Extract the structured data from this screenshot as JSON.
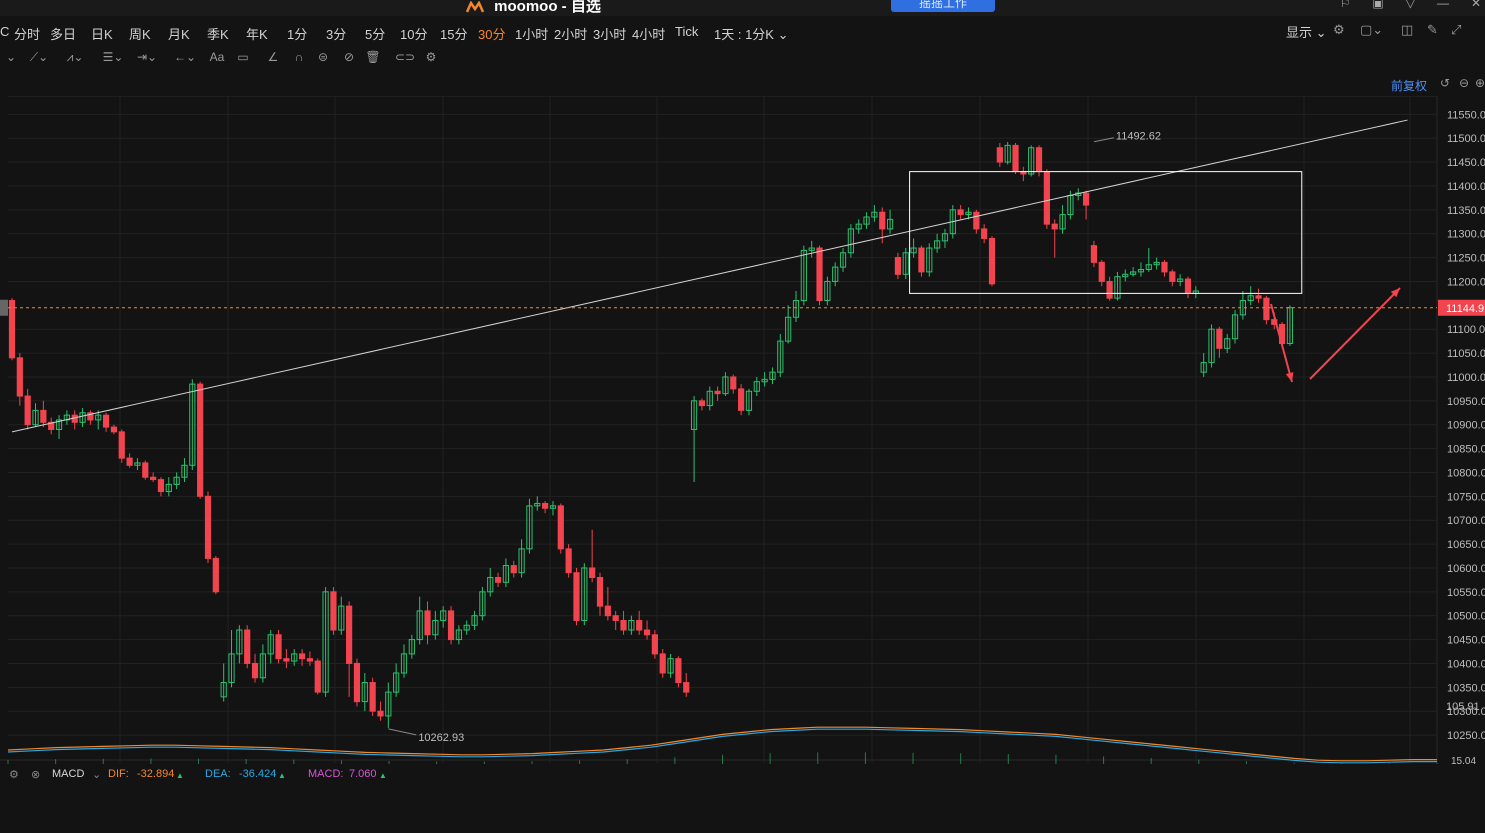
{
  "app": {
    "title": "moomoo - 自选",
    "share_label": "摇摇工作"
  },
  "timeframes": [
    {
      "label": "C",
      "active": false
    },
    {
      "label": "分时",
      "active": false
    },
    {
      "label": "多日",
      "active": false
    },
    {
      "label": "日K",
      "active": false
    },
    {
      "label": "周K",
      "active": false
    },
    {
      "label": "月K",
      "active": false
    },
    {
      "label": "季K",
      "active": false
    },
    {
      "label": "年K",
      "active": false
    },
    {
      "label": "1分",
      "active": false
    },
    {
      "label": "3分",
      "active": false
    },
    {
      "label": "5分",
      "active": false
    },
    {
      "label": "10分",
      "active": false
    },
    {
      "label": "15分",
      "active": false
    },
    {
      "label": "30分",
      "active": true
    },
    {
      "label": "1小时",
      "active": false
    },
    {
      "label": "2小时",
      "active": false
    },
    {
      "label": "3小时",
      "active": false
    },
    {
      "label": "4小时",
      "active": false
    },
    {
      "label": "Tick",
      "active": false
    }
  ],
  "period_select": "1天 : 1分K",
  "display_label": "显示",
  "adjust_label": "前复权",
  "indicator": {
    "name": "MACD",
    "dif_label": "DIF:",
    "dif_value": "-32.894",
    "dea_label": "DEA:",
    "dea_value": "-36.424",
    "macd_label": "MACD:",
    "macd_value": "7.060"
  },
  "colors": {
    "up": "#2cc16f",
    "down": "#f2444e",
    "accent": "#f5872b",
    "dif": "#f5872b",
    "dea": "#2aa8e0",
    "macd": "#d656d6"
  },
  "chart_data": {
    "type": "candlestick",
    "y_ticks": [
      11550,
      11500,
      11450,
      11400,
      11350,
      11300,
      11250,
      11200,
      11100,
      11050,
      11000,
      10950,
      10900,
      10850,
      10800,
      10750,
      10700,
      10650,
      10600,
      10550,
      10500,
      10450,
      10400,
      10350,
      10300,
      10250
    ],
    "y_tick_labels": [
      "11550.00",
      "11500.00",
      "11450.00",
      "11400.00",
      "11350.00",
      "11300.00",
      "11250.00",
      "11200.00",
      "11100.00",
      "11050.00",
      "11000.00",
      "10950.00",
      "10900.00",
      "10850.00",
      "10800.00",
      "10750.00",
      "10700.00",
      "10650.00",
      "10600.00",
      "10550.00",
      "10500.00",
      "10450.00",
      "10400.00",
      "10350.00",
      "10300.00",
      "10250.00"
    ],
    "ylim": [
      10225,
      11580
    ],
    "last_price": 11144.9,
    "last_price_label": "11144.9",
    "max_label": "11492.62",
    "min_label": "10262.93",
    "macd_axis_label": "105.91",
    "macd_axis_label2": "15.04",
    "trendline": [
      [
        0,
        10885
      ],
      [
        178,
        11538
      ]
    ],
    "box": {
      "from": 115,
      "to": 164,
      "high": 11430,
      "low": 11175
    },
    "candles": [
      [
        11160,
        11040,
        11165,
        11035
      ],
      [
        11040,
        10960,
        11050,
        10940
      ],
      [
        10960,
        10900,
        10975,
        10890
      ],
      [
        10900,
        10930,
        10945,
        10895
      ],
      [
        10930,
        10905,
        10950,
        10895
      ],
      [
        10905,
        10890,
        10915,
        10880
      ],
      [
        10890,
        10910,
        10920,
        10870
      ],
      [
        10910,
        10920,
        10930,
        10900
      ],
      [
        10920,
        10905,
        10930,
        10890
      ],
      [
        10905,
        10925,
        10935,
        10895
      ],
      [
        10925,
        10910,
        10930,
        10900
      ],
      [
        10910,
        10920,
        10930,
        10890
      ],
      [
        10920,
        10895,
        10925,
        10885
      ],
      [
        10895,
        10885,
        10900,
        10880
      ],
      [
        10885,
        10830,
        10890,
        10820
      ],
      [
        10830,
        10815,
        10840,
        10810
      ],
      [
        10815,
        10820,
        10830,
        10805
      ],
      [
        10820,
        10790,
        10825,
        10785
      ],
      [
        10790,
        10785,
        10800,
        10780
      ],
      [
        10785,
        10760,
        10790,
        10750
      ],
      [
        10760,
        10775,
        10790,
        10750
      ],
      [
        10775,
        10790,
        10800,
        10765
      ],
      [
        10790,
        10815,
        10830,
        10780
      ],
      [
        10815,
        10985,
        10995,
        10805
      ],
      [
        10985,
        10750,
        10990,
        10745
      ],
      [
        10750,
        10620,
        10760,
        10610
      ],
      [
        10620,
        10550,
        10625,
        10545
      ],
      [
        10330,
        10360,
        10400,
        10320
      ],
      [
        10360,
        10420,
        10470,
        10350
      ],
      [
        10420,
        10470,
        10480,
        10400
      ],
      [
        10470,
        10400,
        10480,
        10390
      ],
      [
        10400,
        10370,
        10420,
        10360
      ],
      [
        10370,
        10420,
        10440,
        10360
      ],
      [
        10420,
        10460,
        10470,
        10400
      ],
      [
        10460,
        10410,
        10470,
        10400
      ],
      [
        10410,
        10405,
        10430,
        10390
      ],
      [
        10405,
        10420,
        10430,
        10395
      ],
      [
        10420,
        10410,
        10430,
        10395
      ],
      [
        10410,
        10405,
        10425,
        10395
      ],
      [
        10405,
        10340,
        10410,
        10335
      ],
      [
        10340,
        10550,
        10560,
        10330
      ],
      [
        10550,
        10470,
        10560,
        10460
      ],
      [
        10470,
        10520,
        10540,
        10460
      ],
      [
        10520,
        10400,
        10530,
        10330
      ],
      [
        10400,
        10320,
        10410,
        10310
      ],
      [
        10320,
        10360,
        10380,
        10300
      ],
      [
        10360,
        10300,
        10370,
        10290
      ],
      [
        10300,
        10290,
        10320,
        10280
      ],
      [
        10290,
        10340,
        10360,
        10265
      ],
      [
        10340,
        10380,
        10400,
        10330
      ],
      [
        10380,
        10420,
        10440,
        10370
      ],
      [
        10420,
        10450,
        10460,
        10410
      ],
      [
        10450,
        10510,
        10540,
        10440
      ],
      [
        10510,
        10460,
        10530,
        10440
      ],
      [
        10460,
        10490,
        10510,
        10450
      ],
      [
        10490,
        10510,
        10520,
        10475
      ],
      [
        10510,
        10450,
        10520,
        10440
      ],
      [
        10450,
        10470,
        10480,
        10440
      ],
      [
        10470,
        10480,
        10490,
        10460
      ],
      [
        10480,
        10500,
        10510,
        10470
      ],
      [
        10500,
        10550,
        10560,
        10490
      ],
      [
        10550,
        10580,
        10600,
        10540
      ],
      [
        10580,
        10570,
        10590,
        10560
      ],
      [
        10570,
        10605,
        10620,
        10560
      ],
      [
        10605,
        10590,
        10615,
        10580
      ],
      [
        10590,
        10640,
        10660,
        10580
      ],
      [
        10640,
        10730,
        10745,
        10630
      ],
      [
        10730,
        10735,
        10750,
        10720
      ],
      [
        10735,
        10725,
        10740,
        10715
      ],
      [
        10725,
        10730,
        10740,
        10710
      ],
      [
        10730,
        10640,
        10735,
        10630
      ],
      [
        10640,
        10590,
        10650,
        10580
      ],
      [
        10590,
        10490,
        10600,
        10480
      ],
      [
        10490,
        10600,
        10610,
        10480
      ],
      [
        10600,
        10580,
        10680,
        10570
      ],
      [
        10580,
        10520,
        10590,
        10500
      ],
      [
        10520,
        10500,
        10560,
        10490
      ],
      [
        10500,
        10490,
        10510,
        10470
      ],
      [
        10490,
        10470,
        10510,
        10460
      ],
      [
        10470,
        10490,
        10500,
        10460
      ],
      [
        10490,
        10470,
        10510,
        10460
      ],
      [
        10470,
        10460,
        10490,
        10450
      ],
      [
        10460,
        10420,
        10470,
        10410
      ],
      [
        10420,
        10380,
        10430,
        10370
      ],
      [
        10380,
        10410,
        10420,
        10370
      ],
      [
        10410,
        10360,
        10415,
        10350
      ],
      [
        10360,
        10340,
        10380,
        10330
      ],
      [
        10890,
        10950,
        10960,
        10780
      ],
      [
        10950,
        10940,
        10955,
        10930
      ],
      [
        10940,
        10970,
        10980,
        10930
      ],
      [
        10970,
        10965,
        10980,
        10950
      ],
      [
        10965,
        11000,
        11010,
        10960
      ],
      [
        11000,
        10975,
        11005,
        10965
      ],
      [
        10975,
        10930,
        10985,
        10920
      ],
      [
        10930,
        10970,
        10975,
        10920
      ],
      [
        10970,
        10990,
        11000,
        10960
      ],
      [
        10990,
        10995,
        11010,
        10980
      ],
      [
        10995,
        11010,
        11020,
        10985
      ],
      [
        11010,
        11075,
        11090,
        11000
      ],
      [
        11075,
        11125,
        11150,
        11070
      ],
      [
        11125,
        11160,
        11180,
        11115
      ],
      [
        11160,
        11265,
        11275,
        11150
      ],
      [
        11265,
        11270,
        11285,
        11250
      ],
      [
        11270,
        11160,
        11275,
        11150
      ],
      [
        11160,
        11200,
        11210,
        11150
      ],
      [
        11200,
        11230,
        11240,
        11190
      ],
      [
        11230,
        11260,
        11270,
        11220
      ],
      [
        11260,
        11310,
        11320,
        11250
      ],
      [
        11310,
        11320,
        11330,
        11300
      ],
      [
        11320,
        11335,
        11345,
        11310
      ],
      [
        11335,
        11345,
        11360,
        11325
      ],
      [
        11345,
        11310,
        11355,
        11280
      ],
      [
        11310,
        11330,
        11350,
        11300
      ],
      [
        11250,
        11215,
        11260,
        11205
      ],
      [
        11215,
        11260,
        11270,
        11205
      ],
      [
        11260,
        11270,
        11290,
        11250
      ],
      [
        11270,
        11220,
        11275,
        11210
      ],
      [
        11220,
        11270,
        11280,
        11210
      ],
      [
        11270,
        11285,
        11300,
        11260
      ],
      [
        11285,
        11300,
        11310,
        11270
      ],
      [
        11300,
        11350,
        11360,
        11290
      ],
      [
        11350,
        11340,
        11360,
        11330
      ],
      [
        11340,
        11345,
        11355,
        11330
      ],
      [
        11345,
        11310,
        11350,
        11300
      ],
      [
        11310,
        11290,
        11320,
        11280
      ],
      [
        11290,
        11195,
        11295,
        11190
      ],
      [
        11480,
        11450,
        11490,
        11440
      ],
      [
        11450,
        11485,
        11492,
        11445
      ],
      [
        11485,
        11430,
        11490,
        11425
      ],
      [
        11430,
        11425,
        11440,
        11410
      ],
      [
        11425,
        11480,
        11485,
        11420
      ],
      [
        11480,
        11430,
        11485,
        11420
      ],
      [
        11430,
        11320,
        11435,
        11310
      ],
      [
        11320,
        11310,
        11330,
        11250
      ],
      [
        11310,
        11340,
        11360,
        11300
      ],
      [
        11340,
        11380,
        11390,
        11330
      ],
      [
        11380,
        11385,
        11395,
        11370
      ],
      [
        11385,
        11360,
        11390,
        11330
      ],
      [
        11275,
        11240,
        11285,
        11230
      ],
      [
        11240,
        11200,
        11245,
        11190
      ],
      [
        11200,
        11165,
        11210,
        11160
      ],
      [
        11165,
        11210,
        11220,
        11160
      ],
      [
        11210,
        11215,
        11225,
        11200
      ],
      [
        11215,
        11220,
        11230,
        11210
      ],
      [
        11220,
        11225,
        11240,
        11210
      ],
      [
        11225,
        11235,
        11270,
        11220
      ],
      [
        11235,
        11240,
        11250,
        11225
      ],
      [
        11240,
        11220,
        11245,
        11210
      ],
      [
        11220,
        11200,
        11225,
        11190
      ],
      [
        11200,
        11205,
        11215,
        11190
      ],
      [
        11205,
        11175,
        11210,
        11165
      ],
      [
        11175,
        11180,
        11190,
        11165
      ],
      [
        11010,
        11030,
        11050,
        11000
      ],
      [
        11030,
        11100,
        11110,
        11020
      ],
      [
        11100,
        11060,
        11105,
        11040
      ],
      [
        11060,
        11080,
        11090,
        11050
      ],
      [
        11080,
        11130,
        11140,
        11070
      ],
      [
        11130,
        11160,
        11180,
        11120
      ],
      [
        11160,
        11170,
        11190,
        11150
      ],
      [
        11170,
        11165,
        11185,
        11155
      ],
      [
        11165,
        11120,
        11170,
        11110
      ],
      [
        11120,
        11110,
        11135,
        11100
      ],
      [
        11110,
        11070,
        11115,
        11060
      ],
      [
        11070,
        11145,
        11150,
        11065
      ]
    ],
    "macd_line": [
      20,
      22,
      24,
      25,
      26,
      27,
      28,
      28,
      27,
      26,
      25,
      24,
      22,
      20,
      18,
      16,
      15,
      14,
      13,
      12,
      12,
      13,
      14,
      16,
      18,
      20,
      24,
      28,
      34,
      40,
      46,
      50,
      54,
      56,
      58,
      58,
      58,
      57,
      56,
      55,
      54,
      52,
      50,
      48,
      46,
      42,
      38,
      34,
      30,
      26,
      22,
      18,
      14,
      10,
      6,
      3,
      2,
      2,
      3,
      4,
      4
    ]
  }
}
